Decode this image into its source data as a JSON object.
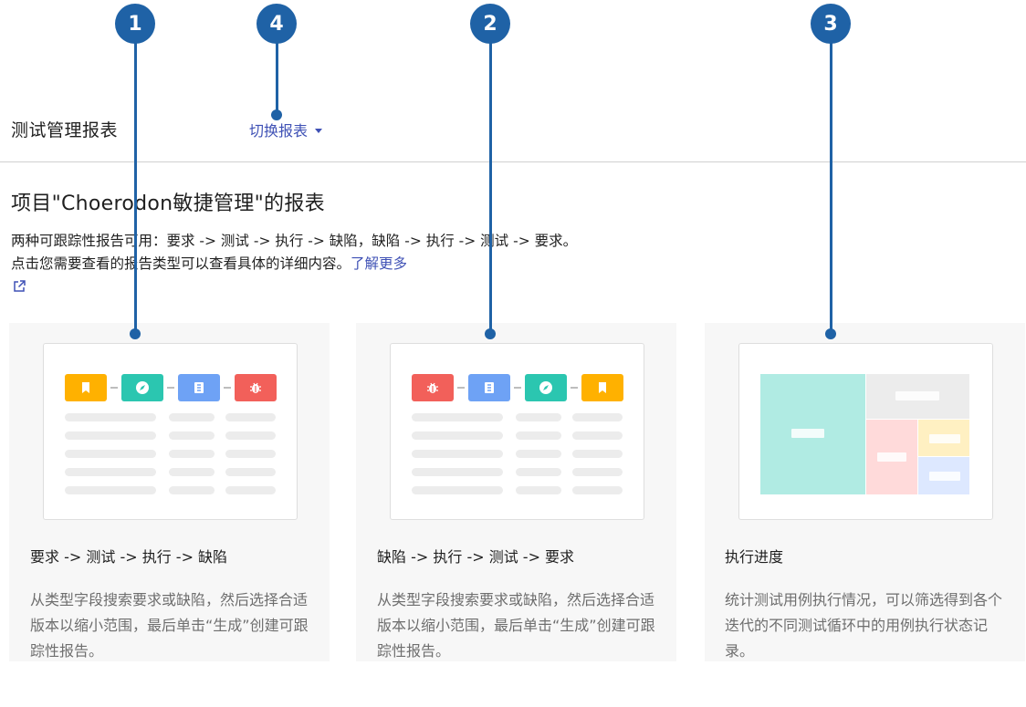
{
  "header": {
    "title": "测试管理报表",
    "switch_label": "切换报表"
  },
  "intro": {
    "heading": "项目\"Choerodon敏捷管理\"的报表",
    "description": "两种可跟踪性报告可用：要求 -> 测试 -> 执行 -> 缺陷，缺陷 -> 执行 -> 测试 -> 要求。 点击您需要查看的报告类型可以查看具体的详细内容。",
    "learn_more": "了解更多"
  },
  "cards": [
    {
      "title": "要求 -> 测试 -> 执行 -> 缺陷",
      "description": "从类型字段搜索要求或缺陷，然后选择合适版本以缩小范围，最后单击“生成”创建可跟踪性报告。"
    },
    {
      "title": "缺陷 -> 执行 -> 测试 -> 要求",
      "description": "从类型字段搜索要求或缺陷，然后选择合适版本以缩小范围，最后单击“生成”创建可跟踪性报告。"
    },
    {
      "title": "执行进度",
      "description": "统计测试用例执行情况，可以筛选得到各个迭代的不同测试循环中的用例执行状态记录。"
    }
  ],
  "callouts": [
    "1",
    "4",
    "2",
    "3"
  ],
  "colors": {
    "accent": "#3f51b5",
    "callout": "#1f62a6",
    "tile_bookmark": "#ffb100",
    "tile_compass": "#2bc6b0",
    "tile_doc": "#6ea2f5",
    "tile_bug": "#f2605a",
    "mosaic_teal": "#b0ebe3",
    "mosaic_grey": "#ececec",
    "mosaic_pink": "#ffdada",
    "mosaic_yellow": "#fff0c2",
    "mosaic_blue": "#dde8ff"
  },
  "icons": {
    "tile_order_card1": [
      "bookmark-icon",
      "compass-icon",
      "document-icon",
      "bug-icon"
    ],
    "tile_order_card2": [
      "bug-icon",
      "document-icon",
      "compass-icon",
      "bookmark-icon"
    ],
    "external": "external-link-icon"
  }
}
